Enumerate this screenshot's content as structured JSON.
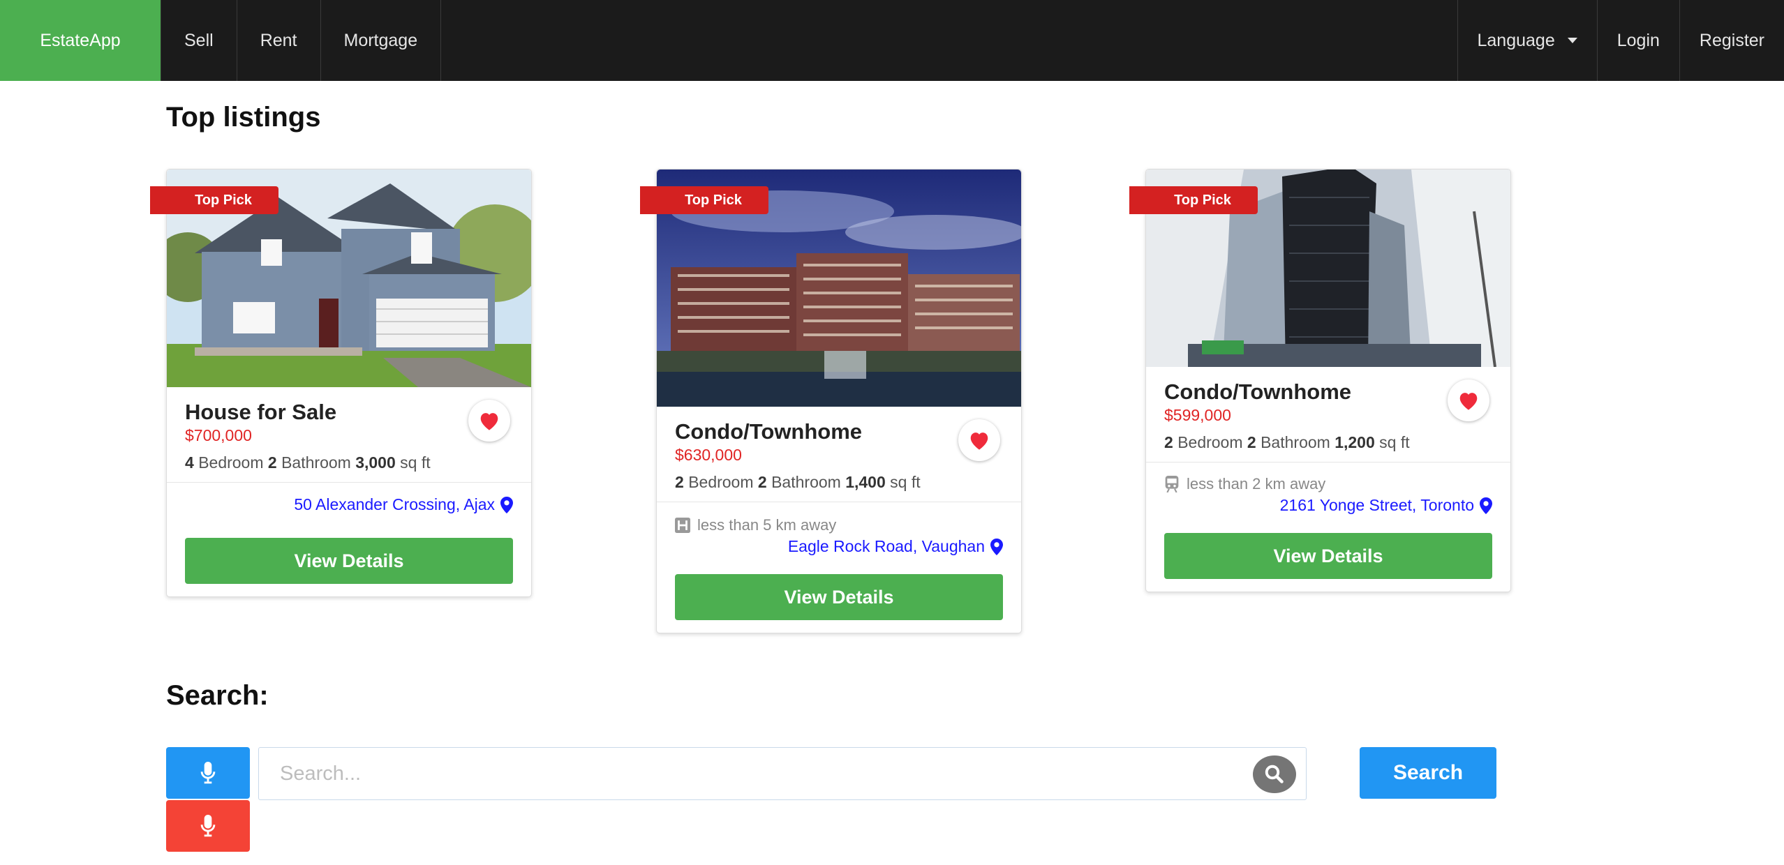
{
  "nav": {
    "brand": "EstateApp",
    "left_items": [
      "Sell",
      "Rent",
      "Mortgage"
    ],
    "language_label": "Language",
    "login_label": "Login",
    "register_label": "Register"
  },
  "top_listings": {
    "heading": "Top listings",
    "badge": "Top Pick",
    "cards": [
      {
        "title": "House for Sale",
        "price": "$700,000",
        "bedrooms": "4",
        "bedroom_label": "Bedroom",
        "bathrooms": "2",
        "bathroom_label": "Bathroom",
        "area": "3,000",
        "area_unit": "sq ft",
        "distance": "",
        "address": "50 Alexander Crossing, Ajax",
        "button": "View Details"
      },
      {
        "title": "Condo/Townhome",
        "price": "$630,000",
        "bedrooms": "2",
        "bedroom_label": "Bedroom",
        "bathrooms": "2",
        "bathroom_label": "Bathroom",
        "area": "1,400",
        "area_unit": "sq ft",
        "distance": "less than 5 km away",
        "address": "Eagle Rock Road, Vaughan",
        "button": "View Details"
      },
      {
        "title": "Condo/Townhome",
        "price": "$599,000",
        "bedrooms": "2",
        "bedroom_label": "Bedroom",
        "bathrooms": "2",
        "bathroom_label": "Bathroom",
        "area": "1,200",
        "area_unit": "sq ft",
        "distance": "less than 2 km away",
        "address": "2161 Yonge Street, Toronto",
        "button": "View Details"
      }
    ]
  },
  "search": {
    "heading": "Search:",
    "placeholder": "Search...",
    "button": "Search"
  },
  "colors": {
    "brand_green": "#4caf50",
    "price_red": "#e02424",
    "ribbon_red": "#d42121",
    "address_blue": "#1a1aff",
    "mic_blue": "#2196f3",
    "mic_red": "#f44336"
  },
  "icons": {
    "favorite": "heart-icon",
    "location": "map-marker-icon",
    "hospital": "hospital-icon",
    "transit": "subway-icon",
    "voice": "microphone-icon",
    "search": "search-icon"
  }
}
